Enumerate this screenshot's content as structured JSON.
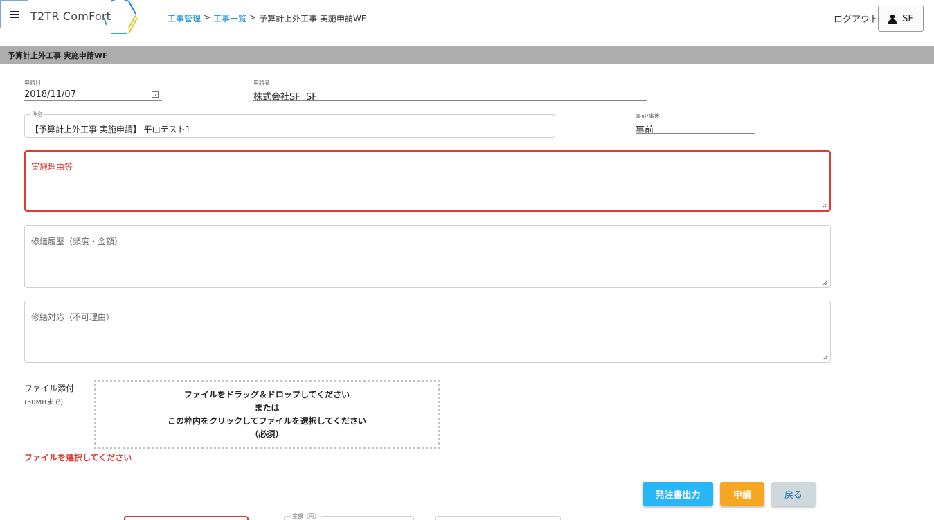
{
  "header": {
    "logo_text": "T2TR ComFort",
    "breadcrumb": {
      "link1": "工事管理",
      "sep1": ">",
      "link2": "工事一覧",
      "sep2": ">",
      "current": "予算計上外工事 実施申請WF"
    },
    "logout_label": "ログアウト",
    "user_label": "SF"
  },
  "section_title": "予算計上外工事 実施申請WF",
  "form": {
    "apply_date": {
      "label": "申請日",
      "value": "2018/11/07"
    },
    "applicant": {
      "label": "申請者",
      "value": "株式会社SF  SF"
    },
    "subject": {
      "label": "件名",
      "value": "【予算計上外工事 実施申請】 平山テスト1"
    },
    "timing": {
      "label": "事前/事後",
      "value": "事前"
    },
    "reason": {
      "placeholder": "実施理由等"
    },
    "history": {
      "placeholder": "修繕履歴（頻度・金額）"
    },
    "response": {
      "placeholder": "修繕対応（不可理由）"
    },
    "attachment": {
      "label": "ファイル添付",
      "limit": "(50MBまで)",
      "drop_line1": "ファイルをドラッグ＆ドロップしてください",
      "drop_line2": "または",
      "drop_line3": "この枠内をクリックしてファイルを選択してください",
      "drop_line4": "（必須）",
      "error": "ファイルを選択してください"
    },
    "amount_label": "金額（円）"
  },
  "buttons": {
    "order_output": "発注書出力",
    "apply": "申請",
    "back": "戻る"
  },
  "colors": {
    "accent_blue": "#29b6f6",
    "accent_orange": "#f5a623",
    "error_red": "#dc3c33",
    "link_blue": "#1a8fd0"
  }
}
